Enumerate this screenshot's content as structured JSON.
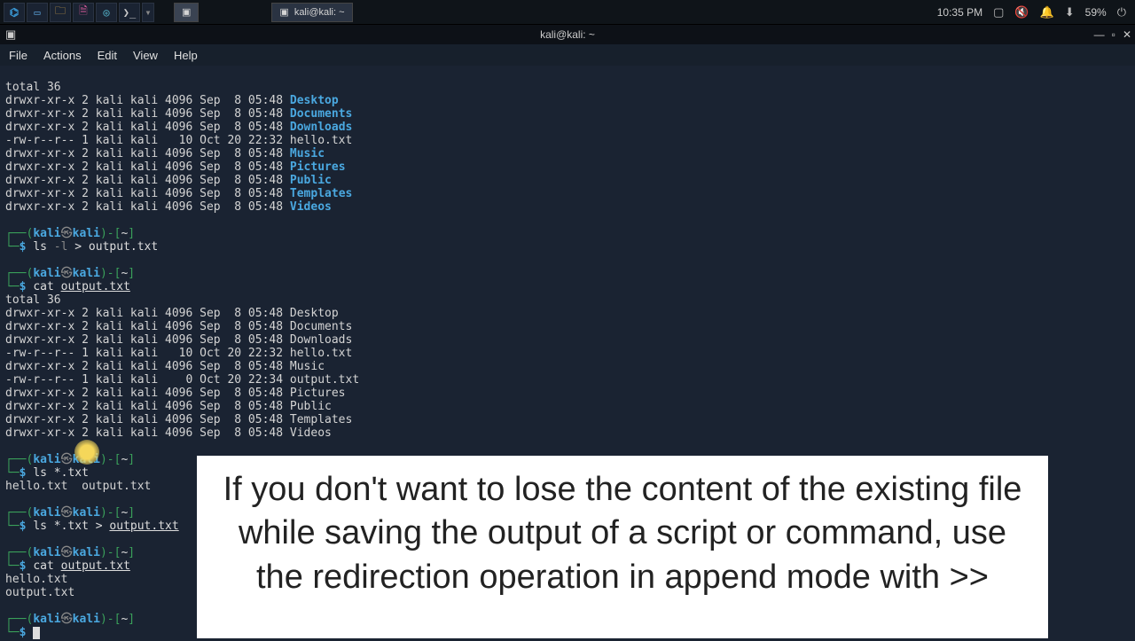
{
  "taskbar": {
    "app_title": "kali@kali: ~",
    "time": "10:35 PM",
    "battery": "59%"
  },
  "window": {
    "title": "kali@kali: ~"
  },
  "menu": {
    "file": "File",
    "actions": "Actions",
    "edit": "Edit",
    "view": "View",
    "help": "Help"
  },
  "ls1": {
    "total": "total 36",
    "r0": "drwxr-xr-x 2 kali kali 4096 Sep  8 05:48 ",
    "d0": "Desktop",
    "r1": "drwxr-xr-x 2 kali kali 4096 Sep  8 05:48 ",
    "d1": "Documents",
    "r2": "drwxr-xr-x 2 kali kali 4096 Sep  8 05:48 ",
    "d2": "Downloads",
    "r3": "-rw-r--r-- 1 kali kali   10 Oct 20 22:32 hello.txt",
    "r4": "drwxr-xr-x 2 kali kali 4096 Sep  8 05:48 ",
    "d4": "Music",
    "r5": "drwxr-xr-x 2 kali kali 4096 Sep  8 05:48 ",
    "d5": "Pictures",
    "r6": "drwxr-xr-x 2 kali kali 4096 Sep  8 05:48 ",
    "d6": "Public",
    "r7": "drwxr-xr-x 2 kali kali 4096 Sep  8 05:48 ",
    "d7": "Templates",
    "r8": "drwxr-xr-x 2 kali kali 4096 Sep  8 05:48 ",
    "d8": "Videos"
  },
  "prompt": {
    "open": "┌──(",
    "user": "kali",
    "at": "㉿",
    "host": "kali",
    "close": ")-[",
    "path": "~",
    "end": "]",
    "line2": "└─",
    "dollar": "$"
  },
  "cmd1": {
    "a": "ls ",
    "b": "-l",
    "c": " > output.txt"
  },
  "cmd2": {
    "a": "cat ",
    "b": "output.txt"
  },
  "cat1": {
    "total": "total 36",
    "l0": "drwxr-xr-x 2 kali kali 4096 Sep  8 05:48 Desktop",
    "l1": "drwxr-xr-x 2 kali kali 4096 Sep  8 05:48 Documents",
    "l2": "drwxr-xr-x 2 kali kali 4096 Sep  8 05:48 Downloads",
    "l3": "-rw-r--r-- 1 kali kali   10 Oct 20 22:32 hello.txt",
    "l4": "drwxr-xr-x 2 kali kali 4096 Sep  8 05:48 Music",
    "l5": "-rw-r--r-- 1 kali kali    0 Oct 20 22:34 output.txt",
    "l6": "drwxr-xr-x 2 kali kali 4096 Sep  8 05:48 Pictures",
    "l7": "drwxr-xr-x 2 kali kali 4096 Sep  8 05:48 Public",
    "l8": "drwxr-xr-x 2 kali kali 4096 Sep  8 05:48 Templates",
    "l9": "drwxr-xr-x 2 kali kali 4096 Sep  8 05:48 Videos"
  },
  "cmd3": {
    "a": "ls *.txt"
  },
  "out3": "hello.txt  output.txt",
  "cmd4": {
    "a": "ls *.txt > ",
    "b": "output.txt"
  },
  "cmd5": {
    "a": "cat ",
    "b": "output.txt"
  },
  "out5a": "hello.txt",
  "out5b": "output.txt",
  "caption": "If you don't want to lose the content of the existing file while saving the output of a script or command, use the redirection operation in append mode with >>"
}
